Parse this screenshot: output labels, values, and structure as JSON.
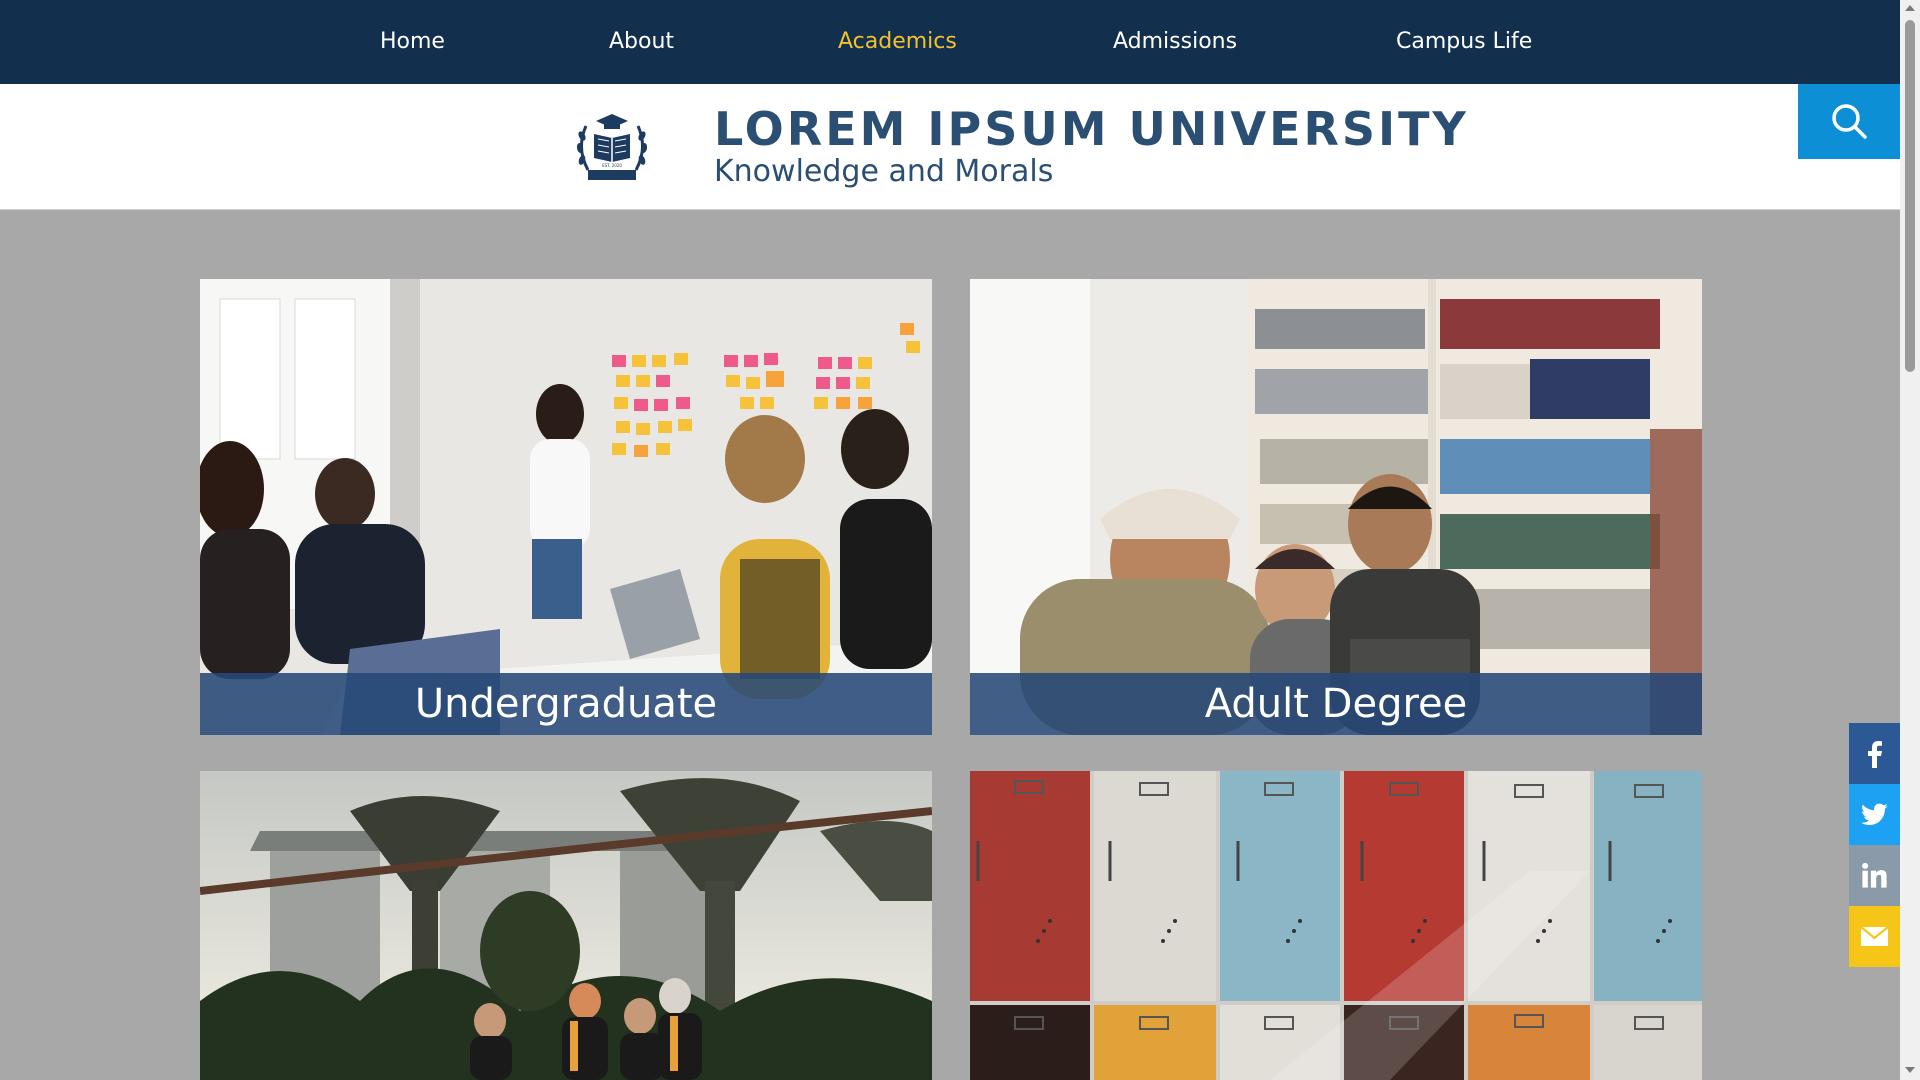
{
  "nav": {
    "items": [
      {
        "label": "Home",
        "active": false
      },
      {
        "label": "About",
        "active": false
      },
      {
        "label": "Academics",
        "active": true
      },
      {
        "label": "Admissions",
        "active": false
      },
      {
        "label": "Campus Life",
        "active": false
      }
    ]
  },
  "header": {
    "title": "LOREM IPSUM UNIVERSITY",
    "tagline": "Knowledge and Morals",
    "logo_icon": "graduation-book-crest-icon",
    "logo_text": "EST. 2020",
    "search_icon": "search-icon"
  },
  "cards": [
    {
      "label": "Undergraduate",
      "image": "students-meeting-sticky-notes-photo"
    },
    {
      "label": "Adult Degree",
      "image": "students-laughing-library-photo"
    },
    {
      "label": "",
      "image": "graduates-gardens-skyline-photo"
    },
    {
      "label": "",
      "image": "colorful-lockers-photo"
    }
  ],
  "social": [
    {
      "name": "facebook-icon",
      "color": "#2d5896"
    },
    {
      "name": "twitter-icon",
      "color": "#1da1f2"
    },
    {
      "name": "linkedin-icon",
      "color": "#8a9aa8"
    },
    {
      "name": "email-icon",
      "color": "#f5c518"
    }
  ],
  "colors": {
    "nav_bg": "#12304e",
    "nav_active": "#f2c12e",
    "brand_text": "#2a4f72",
    "search_bg": "#0d8fd6",
    "page_bg": "#a8a8a8",
    "card_label_bg": "#264876"
  }
}
